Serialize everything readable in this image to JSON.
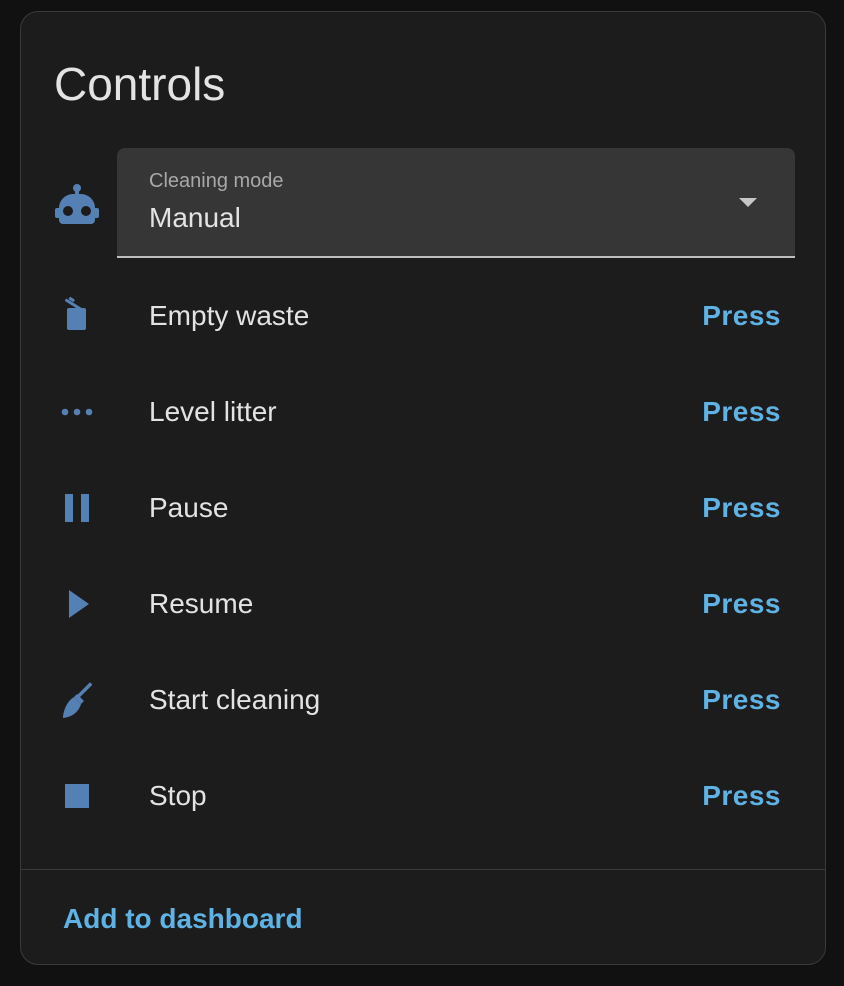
{
  "card": {
    "title": "Controls"
  },
  "select": {
    "icon": "robot-icon",
    "label": "Cleaning mode",
    "value": "Manual"
  },
  "rows": [
    {
      "icon": "trash-can-icon",
      "label": "Empty waste",
      "button": "Press"
    },
    {
      "icon": "dots-horizontal-icon",
      "label": "Level litter",
      "button": "Press"
    },
    {
      "icon": "pause-icon",
      "label": "Pause",
      "button": "Press"
    },
    {
      "icon": "play-icon",
      "label": "Resume",
      "button": "Press"
    },
    {
      "icon": "broom-icon",
      "label": "Start cleaning",
      "button": "Press"
    },
    {
      "icon": "stop-icon",
      "label": "Stop",
      "button": "Press"
    }
  ],
  "footer": {
    "link": "Add to dashboard"
  },
  "colors": {
    "icon": "#5580b4",
    "accent": "#5fb2e4",
    "background": "#1c1c1c",
    "text": "#e3e3e3"
  }
}
